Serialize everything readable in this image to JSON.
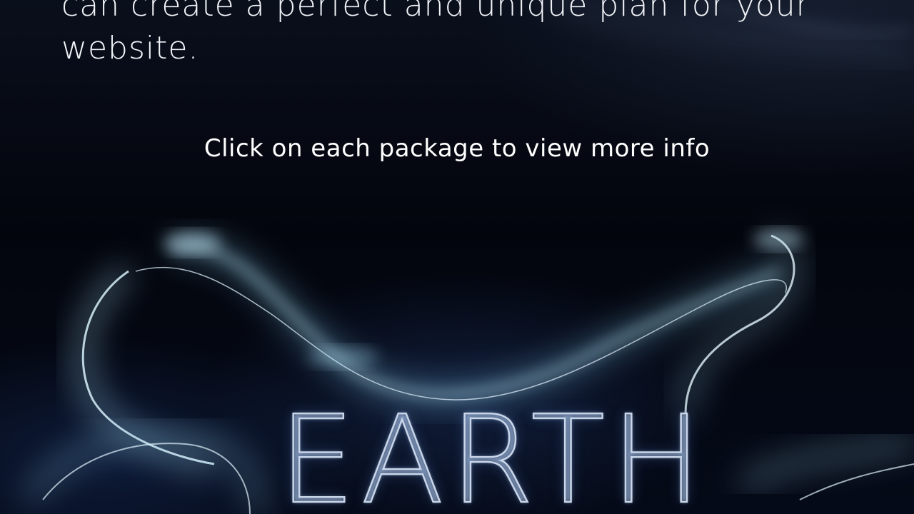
{
  "intro": {
    "text": "can create a perfect and unique plan for your\nwebsite."
  },
  "hint": {
    "text": "Click on each package to view more info"
  },
  "package": {
    "name": "EARTH",
    "art_icon": "silver-ribbon-swirl"
  },
  "colors": {
    "background": "#03050d",
    "text": "#ffffff",
    "ribbon_glow": "#9fd6ec",
    "title_metal": "#c9d6ea"
  }
}
